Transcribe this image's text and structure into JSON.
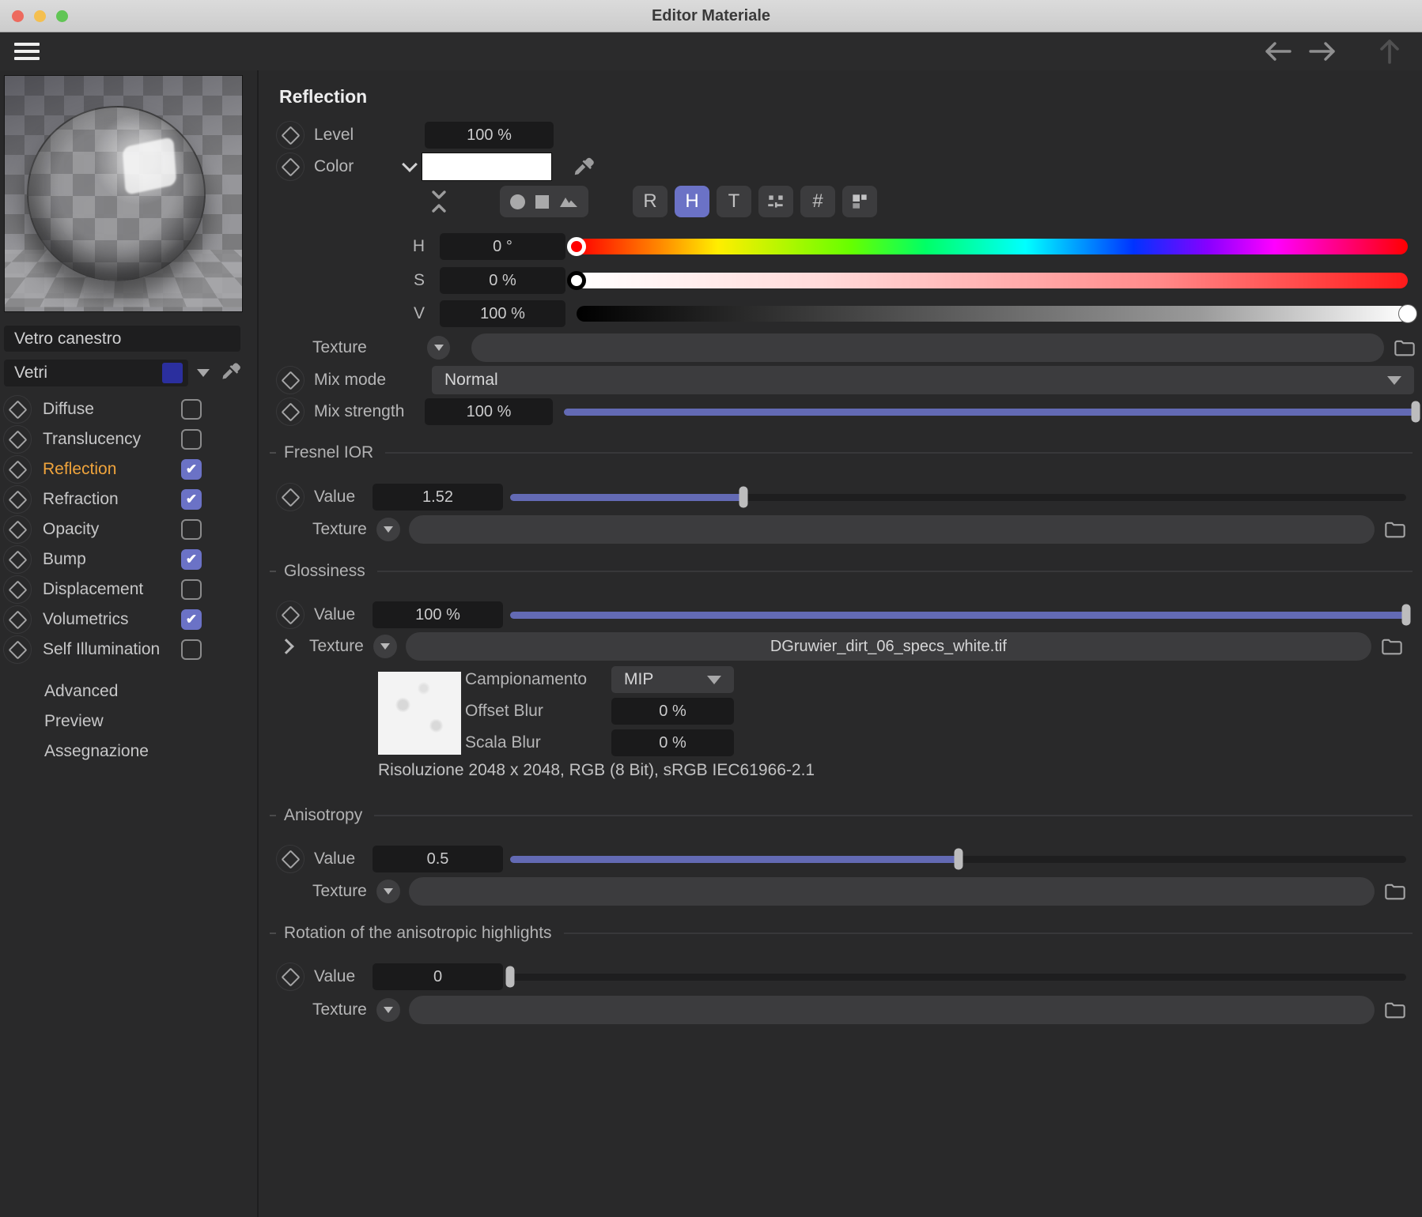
{
  "colors": {
    "accent": "#6b72c6",
    "channel_active": "#f0a43c",
    "tag_swatch": "#2b2f9e",
    "slider_fill": "#636ab4"
  },
  "window": {
    "title": "Editor Materiale"
  },
  "sidebar": {
    "material_name": "Vetro canestro",
    "tag_name": "Vetri",
    "channels": [
      {
        "label": "Diffuse",
        "checked": false,
        "active": false
      },
      {
        "label": "Translucency",
        "checked": false,
        "active": false
      },
      {
        "label": "Reflection",
        "checked": true,
        "active": true
      },
      {
        "label": "Refraction",
        "checked": true,
        "active": false
      },
      {
        "label": "Opacity",
        "checked": false,
        "active": false
      },
      {
        "label": "Bump",
        "checked": true,
        "active": false
      },
      {
        "label": "Displacement",
        "checked": false,
        "active": false
      },
      {
        "label": "Volumetrics",
        "checked": true,
        "active": false
      },
      {
        "label": "Self Illumination",
        "checked": false,
        "active": false
      }
    ],
    "links": [
      "Advanced",
      "Preview",
      "Assegnazione"
    ]
  },
  "panel": {
    "title": "Reflection",
    "level": {
      "label": "Level",
      "value": "100 %"
    },
    "color": {
      "label": "Color"
    },
    "color_modes": [
      {
        "label": "R",
        "active": false
      },
      {
        "label": "H",
        "active": true
      },
      {
        "label": "T",
        "active": false
      },
      {
        "icon": "mixer-icon",
        "active": false
      },
      {
        "label": "#",
        "active": false
      },
      {
        "icon": "swatches-icon",
        "active": false
      }
    ],
    "hsv": {
      "h": {
        "label": "H",
        "value": "0 °",
        "pos": 0
      },
      "s": {
        "label": "S",
        "value": "0 %",
        "pos": 0
      },
      "v": {
        "label": "V",
        "value": "100 %",
        "pos": 100
      }
    },
    "texture": {
      "label": "Texture"
    },
    "mix_mode": {
      "label": "Mix mode",
      "value": "Normal"
    },
    "mix_strength": {
      "label": "Mix strength",
      "value": "100 %",
      "fill_pct": 100
    },
    "fresnel": {
      "header": "Fresnel IOR",
      "value_label": "Value",
      "value": "1.52",
      "fill_pct": 26,
      "texture_label": "Texture"
    },
    "glossiness": {
      "header": "Glossiness",
      "value_label": "Value",
      "value": "100 %",
      "fill_pct": 100,
      "texture_label": "Texture",
      "texture_file": "DGruwier_dirt_06_specs_white.tif",
      "sampling": {
        "label": "Campionamento",
        "value": "MIP"
      },
      "offset_blur": {
        "label": "Offset Blur",
        "value": "0 %"
      },
      "scale_blur": {
        "label": "Scala Blur",
        "value": "0 %"
      },
      "resolution": "Risoluzione 2048 x 2048, RGB (8 Bit), sRGB IEC61966-2.1"
    },
    "anisotropy": {
      "header": "Anisotropy",
      "value_label": "Value",
      "value": "0.5",
      "fill_pct": 50,
      "texture_label": "Texture"
    },
    "rotation": {
      "header": "Rotation of the anisotropic highlights",
      "value_label": "Value",
      "value": "0",
      "fill_pct": 0,
      "texture_label": "Texture"
    }
  }
}
